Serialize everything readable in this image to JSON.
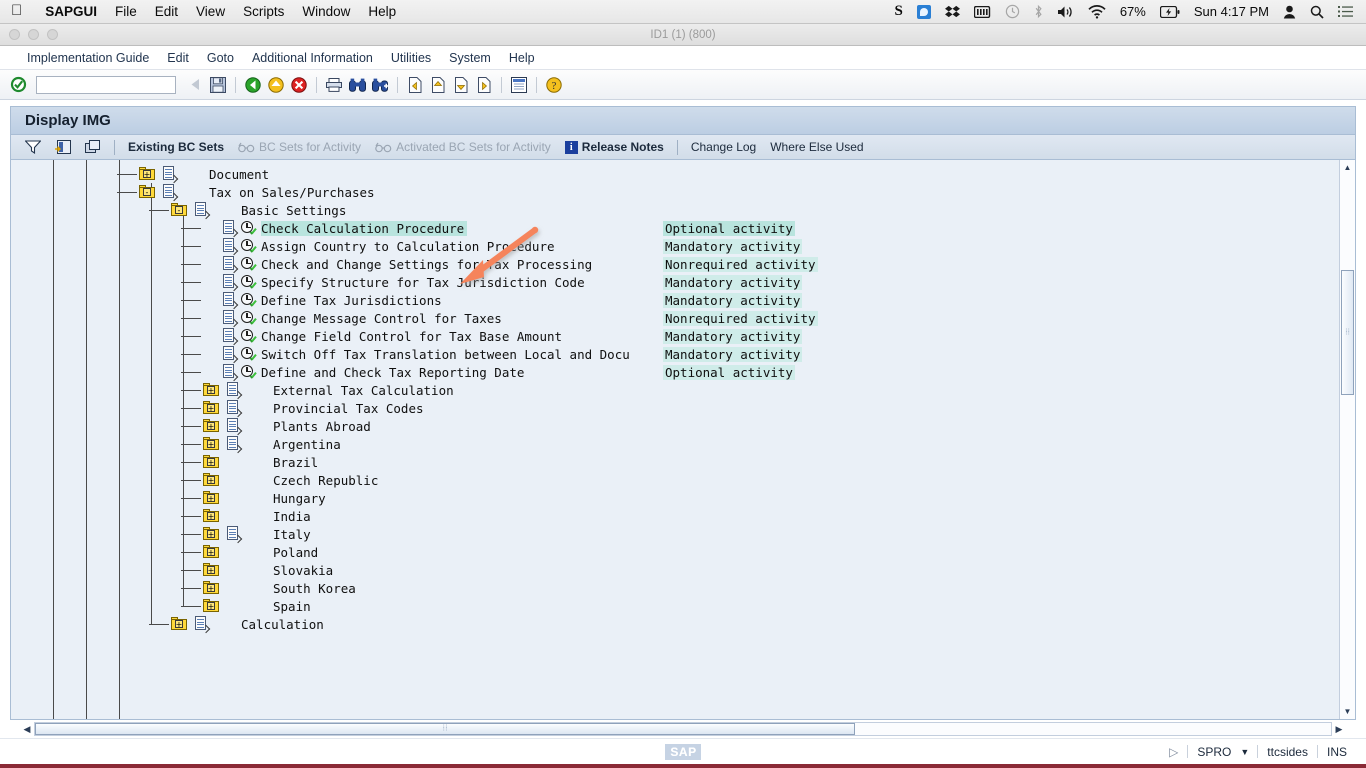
{
  "mac_menu": {
    "apple_icon": "apple-icon",
    "items": [
      {
        "label": "SAPGUI",
        "bold": true
      },
      {
        "label": "File",
        "bold": false
      },
      {
        "label": "Edit",
        "bold": false
      },
      {
        "label": "View",
        "bold": false
      },
      {
        "label": "Scripts",
        "bold": false
      },
      {
        "label": "Window",
        "bold": false
      },
      {
        "label": "Help",
        "bold": false
      }
    ],
    "status": {
      "icons": [
        "s-app-icon",
        "blue-app-icon",
        "dropbox-icon",
        "battery-meter-icon",
        "time-machine-icon",
        "bluetooth-icon",
        "volume-icon",
        "wifi-icon"
      ],
      "battery_percent": "67%",
      "battery_charging_icon": "battery-charging-icon",
      "clock": "Sun 4:17 PM",
      "user_icon": "user-icon",
      "search_icon": "spotlight-search-icon",
      "notification_icon": "notification-center-icon"
    }
  },
  "window": {
    "title": "ID1 (1) (800)",
    "traffic_lights": [
      "close",
      "minimize",
      "zoom"
    ]
  },
  "sap_menu": {
    "items": [
      "Implementation Guide",
      "Edit",
      "Goto",
      "Additional Information",
      "Utilities",
      "System",
      "Help"
    ]
  },
  "toolbar": {
    "enter_icon": "green-check-enter-icon",
    "command_value": "",
    "command_placeholder": "",
    "buttons": [
      "back-dropdown-icon",
      "save-icon",
      "back-green-icon",
      "exit-yellow-icon",
      "cancel-red-icon",
      "print-icon",
      "find-icon",
      "find-next-icon",
      "first-page-icon",
      "previous-page-icon",
      "next-page-icon",
      "last-page-icon",
      "create-session-icon",
      "help-icon"
    ]
  },
  "screen": {
    "title": "Display IMG",
    "actions": [
      {
        "label": "Existing BC Sets",
        "disabled": false,
        "icon": "bc-set-icon"
      },
      {
        "label": "BC Sets for Activity",
        "disabled": true,
        "icon": "glasses-icon"
      },
      {
        "label": "Activated BC Sets for Activity",
        "disabled": true,
        "icon": "glasses-icon"
      },
      {
        "label": "Release Notes",
        "disabled": false,
        "icon": "info-blue-icon"
      },
      {
        "label": "Change Log",
        "disabled": false,
        "icon": ""
      },
      {
        "label": "Where Else Used",
        "disabled": false,
        "icon": ""
      }
    ],
    "action_icons": [
      "filter-icon",
      "select-detail-icon",
      "layout-icon"
    ]
  },
  "tree": {
    "rows": [
      {
        "label": "Document",
        "status": "",
        "indent": 0,
        "icon": "folder-collapsed",
        "expander": "+",
        "doc": true,
        "selected": false
      },
      {
        "label": "Tax on Sales/Purchases",
        "status": "",
        "indent": 0,
        "icon": "folder-expanded",
        "expander": "-",
        "doc": true,
        "selected": false
      },
      {
        "label": "Basic Settings",
        "status": "",
        "indent": 1,
        "icon": "folder-expanded",
        "expander": "-",
        "doc": true,
        "selected": false
      },
      {
        "label": "Check Calculation Procedure",
        "status": "Optional activity",
        "indent": 2,
        "icon": "activity",
        "expander": "",
        "doc": true,
        "selected": true
      },
      {
        "label": "Assign Country to Calculation Procedure",
        "status": "Mandatory activity",
        "indent": 2,
        "icon": "activity",
        "expander": "",
        "doc": true,
        "selected": false
      },
      {
        "label": "Check and Change Settings for Tax Processing",
        "status": "Nonrequired activity",
        "indent": 2,
        "icon": "activity",
        "expander": "",
        "doc": true,
        "selected": false
      },
      {
        "label": "Specify Structure for Tax Jurisdiction Code",
        "status": "Mandatory activity",
        "indent": 2,
        "icon": "activity",
        "expander": "",
        "doc": true,
        "selected": false
      },
      {
        "label": "Define Tax Jurisdictions",
        "status": "Mandatory activity",
        "indent": 2,
        "icon": "activity",
        "expander": "",
        "doc": true,
        "selected": false
      },
      {
        "label": "Change Message Control for Taxes",
        "status": "Nonrequired activity",
        "indent": 2,
        "icon": "activity",
        "expander": "",
        "doc": true,
        "selected": false
      },
      {
        "label": "Change Field Control for Tax Base Amount",
        "status": "Mandatory activity",
        "indent": 2,
        "icon": "activity",
        "expander": "",
        "doc": true,
        "selected": false
      },
      {
        "label": "Switch Off Tax Translation between Local and Docu",
        "status": "Mandatory activity",
        "indent": 2,
        "icon": "activity",
        "expander": "",
        "doc": true,
        "selected": false
      },
      {
        "label": "Define and Check Tax Reporting Date",
        "status": "Optional activity",
        "indent": 2,
        "icon": "activity",
        "expander": "",
        "doc": true,
        "selected": false
      },
      {
        "label": "External Tax Calculation",
        "status": "",
        "indent": 2,
        "icon": "folder-collapsed",
        "expander": "+",
        "doc": true,
        "selected": false
      },
      {
        "label": "Provincial Tax Codes",
        "status": "",
        "indent": 2,
        "icon": "folder-collapsed",
        "expander": "+",
        "doc": true,
        "selected": false
      },
      {
        "label": "Plants Abroad",
        "status": "",
        "indent": 2,
        "icon": "folder-collapsed",
        "expander": "+",
        "doc": true,
        "selected": false
      },
      {
        "label": "Argentina",
        "status": "",
        "indent": 2,
        "icon": "folder-collapsed",
        "expander": "+",
        "doc": true,
        "selected": false
      },
      {
        "label": "Brazil",
        "status": "",
        "indent": 2,
        "icon": "folder-collapsed",
        "expander": "+",
        "doc": false,
        "selected": false
      },
      {
        "label": "Czech Republic",
        "status": "",
        "indent": 2,
        "icon": "folder-collapsed",
        "expander": "+",
        "doc": false,
        "selected": false
      },
      {
        "label": "Hungary",
        "status": "",
        "indent": 2,
        "icon": "folder-collapsed",
        "expander": "+",
        "doc": false,
        "selected": false
      },
      {
        "label": "India",
        "status": "",
        "indent": 2,
        "icon": "folder-collapsed",
        "expander": "+",
        "doc": false,
        "selected": false
      },
      {
        "label": "Italy",
        "status": "",
        "indent": 2,
        "icon": "folder-collapsed",
        "expander": "+",
        "doc": true,
        "selected": false
      },
      {
        "label": "Poland",
        "status": "",
        "indent": 2,
        "icon": "folder-collapsed",
        "expander": "+",
        "doc": false,
        "selected": false
      },
      {
        "label": "Slovakia",
        "status": "",
        "indent": 2,
        "icon": "folder-collapsed",
        "expander": "+",
        "doc": false,
        "selected": false
      },
      {
        "label": "South Korea",
        "status": "",
        "indent": 2,
        "icon": "folder-collapsed",
        "expander": "+",
        "doc": false,
        "selected": false
      },
      {
        "label": "Spain",
        "status": "",
        "indent": 2,
        "icon": "folder-collapsed",
        "expander": "+",
        "doc": false,
        "selected": false
      },
      {
        "label": "Calculation",
        "status": "",
        "indent": 1,
        "icon": "folder-collapsed",
        "expander": "+",
        "doc": true,
        "selected": false
      }
    ]
  },
  "status_bar": {
    "logo": "SAP",
    "execute_icon": "execute-triangle-icon",
    "transaction": "SPRO",
    "dropdown_icon": "chevron-down-icon",
    "system": "ttcsides",
    "insert_mode": "INS"
  },
  "annotation": {
    "arrow_color": "#F5845C",
    "points_to": "Check Calculation Procedure"
  }
}
